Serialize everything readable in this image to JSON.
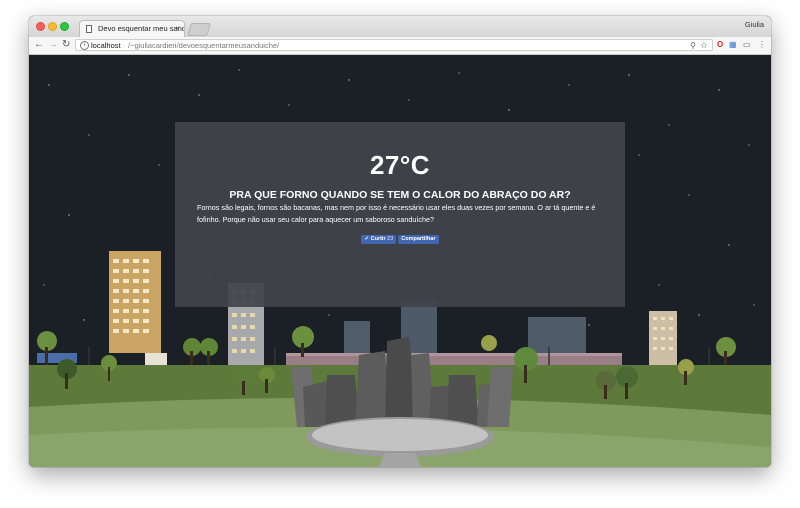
{
  "browser": {
    "tab_title": "Devo esquentar meu sanduíche",
    "tab_close": "×",
    "profile_name": "Giulia",
    "url_host": "localhost",
    "url_path": "/~giuliacardieri/devoesquentarmeusanduiche/",
    "icons": {
      "back": "back-arrow-icon",
      "forward": "forward-arrow-icon",
      "reload": "reload-icon",
      "info": "info-icon",
      "zoom": "zoom-icon",
      "bookmark": "star-icon",
      "opera": "opera-icon",
      "extension": "extension-icon",
      "cast": "cast-icon",
      "menu": "menu-icon"
    }
  },
  "page": {
    "temperature": "27°C",
    "headline": "PRA QUE FORNO QUANDO SE TEM O CALOR DO ABRAÇO DO AR?",
    "description": "Fornos são legais, fornos são bacanas, mas nem por isso é necessário usar eles duas vezes por semana. O ar tá quente e é fofinho. Porque não usar seu calor para aquecer um saboroso sanduíche?",
    "like_label": "Curtir",
    "like_count": "23",
    "share_label": "Compartilhar"
  },
  "colors": {
    "sky": "#1b1f26",
    "card": "#42444b",
    "grass": "#5c7a3a",
    "facebook": "#4267b2"
  }
}
